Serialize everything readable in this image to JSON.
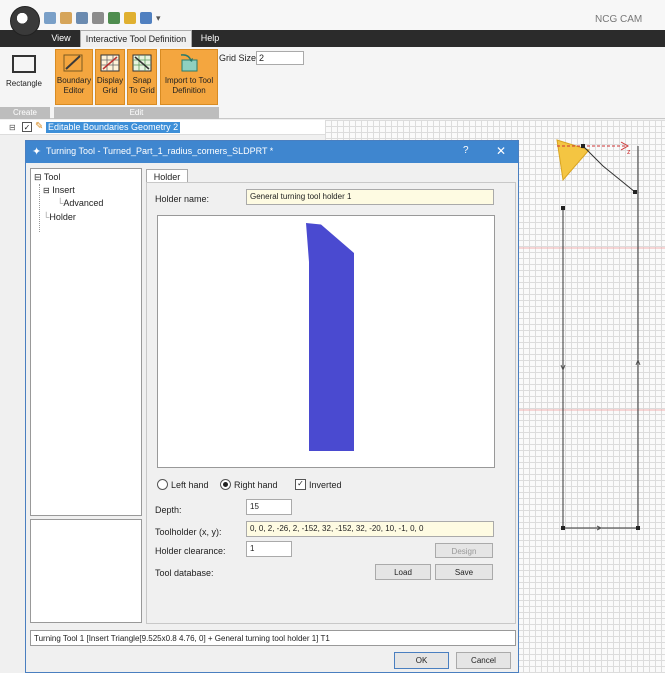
{
  "app": {
    "title": "NCG CAM"
  },
  "ribbon": {
    "tabs": [
      "View",
      "Interactive Tool Definition",
      "Help"
    ],
    "create": {
      "button": [
        "Rectangle"
      ],
      "group_label": "Create"
    },
    "edit": {
      "buttons": [
        {
          "line1": "Boundary",
          "line2": "Editor",
          "icon": "boundary-editor-icon"
        },
        {
          "line1": "Display",
          "line2": "Grid",
          "icon": "display-grid-icon"
        },
        {
          "line1": "Snap",
          "line2": "To Grid",
          "icon": "snap-to-grid-icon"
        },
        {
          "line1": "Import to Tool",
          "line2": "Definition",
          "icon": "import-tool-icon"
        }
      ],
      "grid_size_label": "Grid Size:",
      "grid_size_value": "2",
      "group_label": "Edit"
    },
    "accent_color": "#f4a63f"
  },
  "geometry_tree": {
    "label": "Editable Boundaries Geometry 2",
    "checked": true
  },
  "dialog": {
    "title": "Turning Tool - Turned_Part_1_radius_corners_SLDPRT *",
    "help": "?",
    "close": "✕",
    "tree": {
      "root": "Tool",
      "insert": "Insert",
      "advanced": "Advanced",
      "holder": "Holder"
    },
    "tab": "Holder",
    "holder_name_label": "Holder name:",
    "holder_name_value": "General turning tool holder 1",
    "hand": {
      "left": "Left hand",
      "right": "Right hand",
      "selected": "right"
    },
    "inverted": {
      "label": "Inverted",
      "checked": true
    },
    "depth_label": "Depth:",
    "depth_value": "15",
    "toolholder_label": "Toolholder (x, y):",
    "toolholder_value": "0, 0, 2, -26, 2, -152, 32, -152, 32, -20, 10, -1, 0, 0",
    "clearance_label": "Holder clearance:",
    "clearance_value": "1",
    "design_button": "Design",
    "tool_database_label": "Tool database:",
    "load_button": "Load",
    "save_button": "Save",
    "status": "Turning Tool 1 [Insert Triangle[9.525x0.8 4.76, 0] + General turning tool holder 1] T1",
    "ok_button": "OK",
    "cancel_button": "Cancel",
    "holder_color": "#4a4ad0",
    "title_color": "#3f86cf"
  },
  "preview_profile": [
    [
      0,
      0
    ],
    [
      2,
      -26
    ],
    [
      2,
      -152
    ],
    [
      32,
      -152
    ],
    [
      32,
      -20
    ],
    [
      10,
      -1
    ],
    [
      0,
      0
    ]
  ]
}
